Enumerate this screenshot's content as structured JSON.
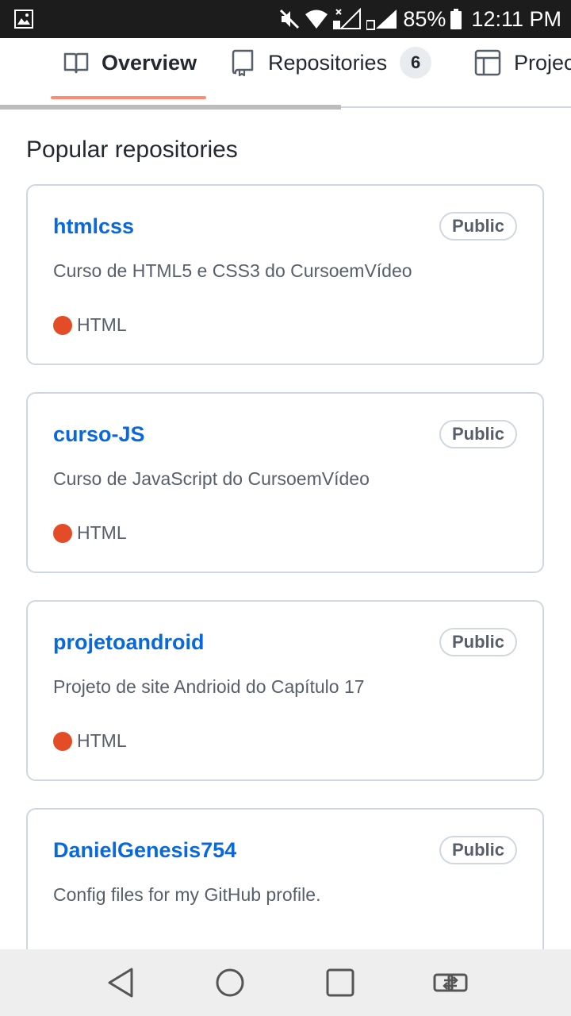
{
  "status_bar": {
    "battery_percent": "85%",
    "time": "12:11 PM",
    "icons": [
      "image-icon",
      "mute-icon",
      "wifi-icon",
      "signal-sim1-icon",
      "signal-sim2-icon",
      "battery-icon"
    ]
  },
  "tabs": [
    {
      "label": "Overview",
      "icon": "book-icon",
      "selected": true
    },
    {
      "label": "Repositories",
      "icon": "repo-icon",
      "count": "6"
    },
    {
      "label": "Projects",
      "visible_text": "Projec",
      "icon": "project-icon"
    }
  ],
  "main": {
    "section_title": "Popular repositories",
    "repos": [
      {
        "name": "htmlcss",
        "visibility": "Public",
        "description": "Curso de HTML5 e CSS3 do CursoemVídeo",
        "language": "HTML",
        "language_color": "#e34c26"
      },
      {
        "name": "curso-JS",
        "visibility": "Public",
        "description": "Curso de JavaScript do CursoemVídeo",
        "language": "HTML",
        "language_color": "#e34c26"
      },
      {
        "name": "projetoandroid",
        "visibility": "Public",
        "description": "Projeto de site Andrioid do Capítulo 17",
        "language": "HTML",
        "language_color": "#e34c26"
      },
      {
        "name": "DanielGenesis754",
        "visibility": "Public",
        "description": "Config files for my GitHub profile."
      }
    ]
  },
  "nav_bar": {
    "buttons": [
      "back-icon",
      "home-icon",
      "recents-icon",
      "switch-app-icon"
    ]
  },
  "colors": {
    "link": "#0969da",
    "tab_underline": "#fd8c73",
    "border": "#d0d7de",
    "muted_text": "#57606a"
  }
}
